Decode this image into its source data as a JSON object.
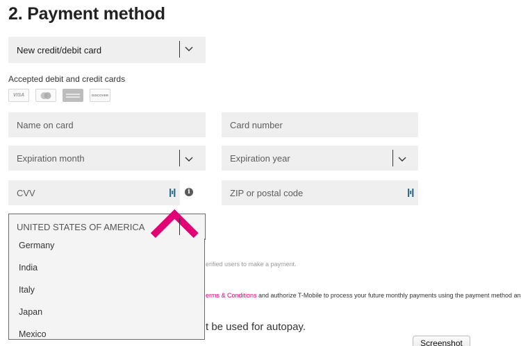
{
  "heading": "2. Payment method",
  "payment_select": {
    "value": "New credit/debit card"
  },
  "accepted_label": "Accepted debit and credit cards",
  "cards": [
    {
      "name": "visa",
      "text": "VISA"
    },
    {
      "name": "mastercard",
      "text": ""
    },
    {
      "name": "amex",
      "text": ""
    },
    {
      "name": "discover",
      "text": "DISCOVER"
    }
  ],
  "fields": {
    "name_on_card": "Name on card",
    "card_number": "Card number",
    "expiration_month": "Expiration month",
    "expiration_year": "Expiration year",
    "cvv": "CVV",
    "zip": "ZIP or postal code"
  },
  "country_select": {
    "value": "UNITED STATES OF AMERICA",
    "options": [
      "Germany",
      "India",
      "Italy",
      "Japan",
      "Mexico"
    ]
  },
  "background_text": {
    "line1": "erified users to make a payment.",
    "line2_link": "erms & Conditions",
    "line2_rest": " and authorize T-Mobile to process your future monthly payments using the payment method and in",
    "line3": "t be used for autopay."
  },
  "screenshot_button": "Screenshot",
  "colors": {
    "accent": "#e20074",
    "field_bg": "#efefef",
    "icon_teal": "#2d6f8c"
  }
}
